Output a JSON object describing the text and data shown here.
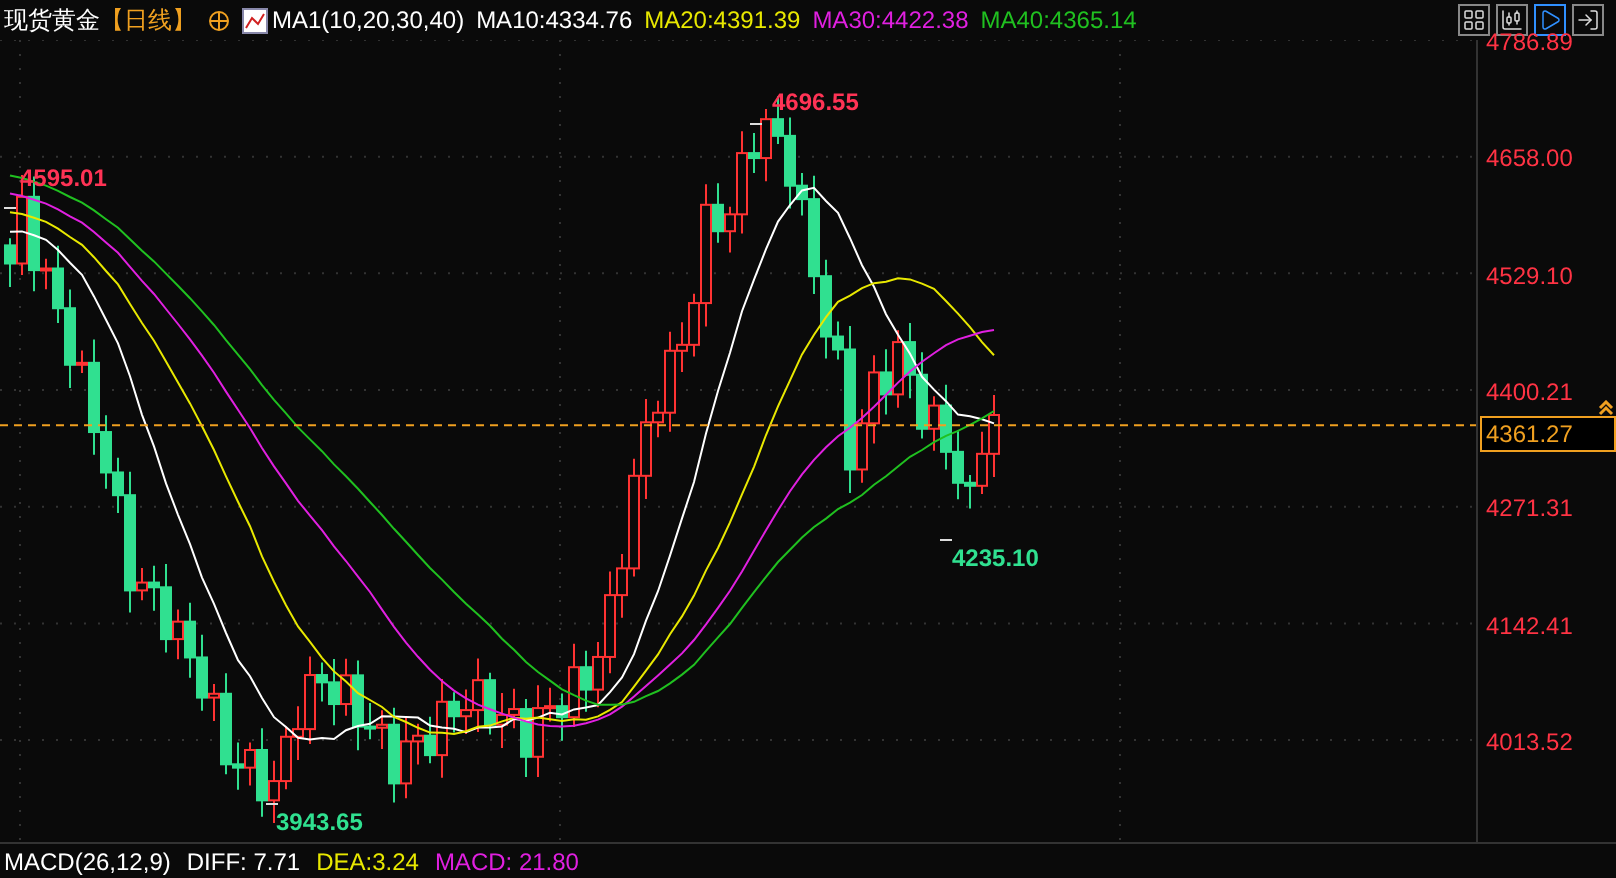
{
  "header": {
    "title": "现货黄金",
    "period": "【日线】",
    "indicator": "MA1(10,20,30,40)",
    "ma_values": [
      {
        "label": "MA10:4334.76",
        "color": "#ffffff"
      },
      {
        "label": "MA20:4391.39",
        "color": "#e8e800"
      },
      {
        "label": "MA30:4422.38",
        "color": "#e020e0"
      },
      {
        "label": "MA40:4365.14",
        "color": "#20c020"
      }
    ]
  },
  "toolbar": [
    {
      "selected": false
    },
    {
      "selected": false
    },
    {
      "selected": true
    },
    {
      "selected": false
    }
  ],
  "price_axis": {
    "labels": [
      "4786.89",
      "4658.00",
      "4529.10",
      "4400.21",
      "4271.31",
      "4142.41",
      "4013.52"
    ],
    "current_price": "4361.27"
  },
  "annotations": [
    {
      "text": "4696.55",
      "kind": "high"
    },
    {
      "text": "4595.01",
      "kind": "high"
    },
    {
      "text": "4235.10",
      "kind": "low"
    },
    {
      "text": "3943.65",
      "kind": "low"
    }
  ],
  "macd": {
    "label": "MACD(26,12,9)",
    "values": [
      {
        "label": "DIFF: 7.71",
        "color": "#ffffff"
      },
      {
        "label": "DEA:3.24",
        "color": "#e8e800"
      },
      {
        "label": "MACD: 21.80",
        "color": "#e020e0"
      }
    ]
  }
}
